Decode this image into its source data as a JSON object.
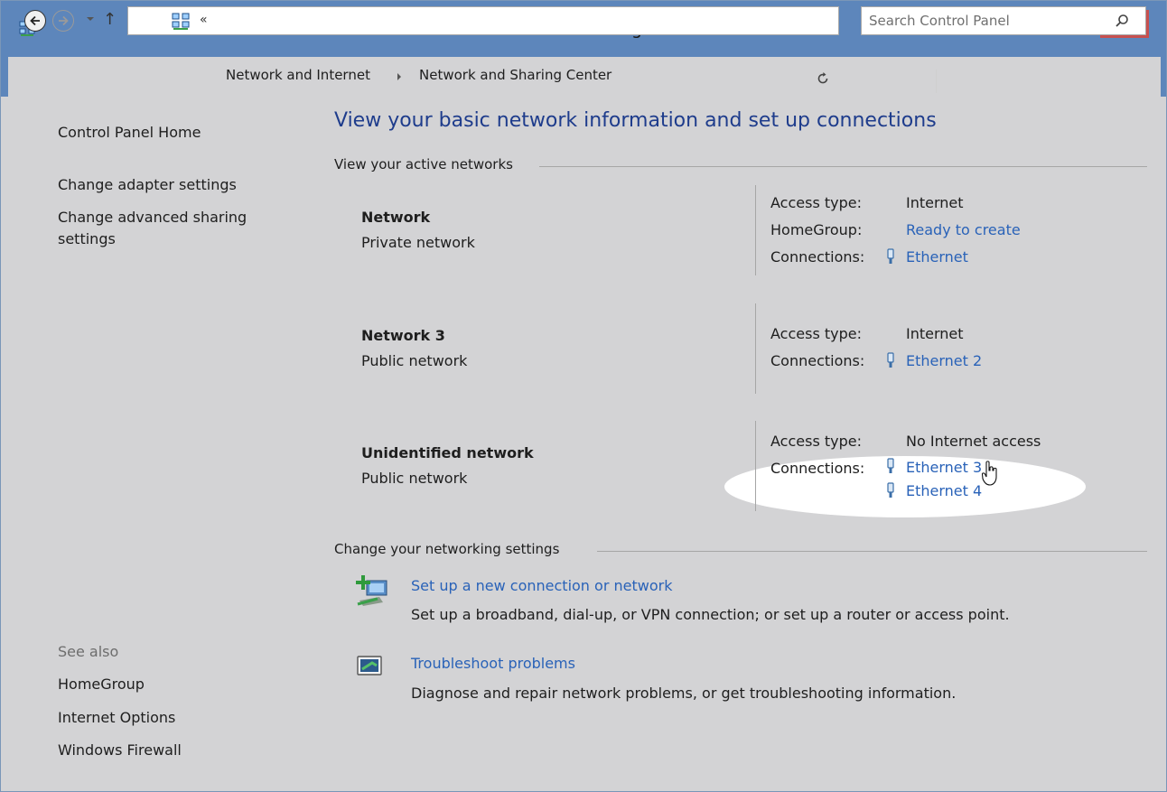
{
  "window": {
    "title": "Network and Sharing Center"
  },
  "nav": {
    "breadcrumb_lead": "«",
    "crumbs": [
      "Network and Internet",
      "Network and Sharing Center"
    ],
    "search_placeholder": "Search Control Panel"
  },
  "sidebar": {
    "home": "Control Panel Home",
    "links": [
      "Change adapter settings",
      "Change advanced sharing",
      "settings"
    ],
    "see_also_label": "See also",
    "see_also": [
      "HomeGroup",
      "Internet Options",
      "Windows Firewall"
    ]
  },
  "main": {
    "heading": "View your basic network information and set up connections",
    "active_label": "View your active networks",
    "networks": [
      {
        "name": "Network",
        "category": "Private network",
        "access_key": "Access type:",
        "access_value": "Internet",
        "homegroup_key": "HomeGroup:",
        "homegroup_value": "Ready to create",
        "connections_key": "Connections:",
        "connections": [
          "Ethernet"
        ]
      },
      {
        "name": "Network  3",
        "category": "Public network",
        "access_key": "Access type:",
        "access_value": "Internet",
        "connections_key": "Connections:",
        "connections": [
          "Ethernet 2"
        ]
      },
      {
        "name": "Unidentified network",
        "category": "Public network",
        "access_key": "Access type:",
        "access_value": "No Internet access",
        "connections_key": "Connections:",
        "connections": [
          "Ethernet 3",
          "Ethernet 4"
        ]
      }
    ],
    "settings_label": "Change your networking settings",
    "tasks": [
      {
        "link": "Set up a new connection or network",
        "desc": "Set up a broadband, dial-up, or VPN connection; or set up a router or access point."
      },
      {
        "link": "Troubleshoot problems",
        "desc": "Diagnose and repair network problems, or get troubleshooting information."
      }
    ]
  },
  "colors": {
    "titlebar": "#5d86bb",
    "close": "#c7504f",
    "link": "#2962b8",
    "heading": "#1e3c8c",
    "background": "#d3d3d5"
  }
}
